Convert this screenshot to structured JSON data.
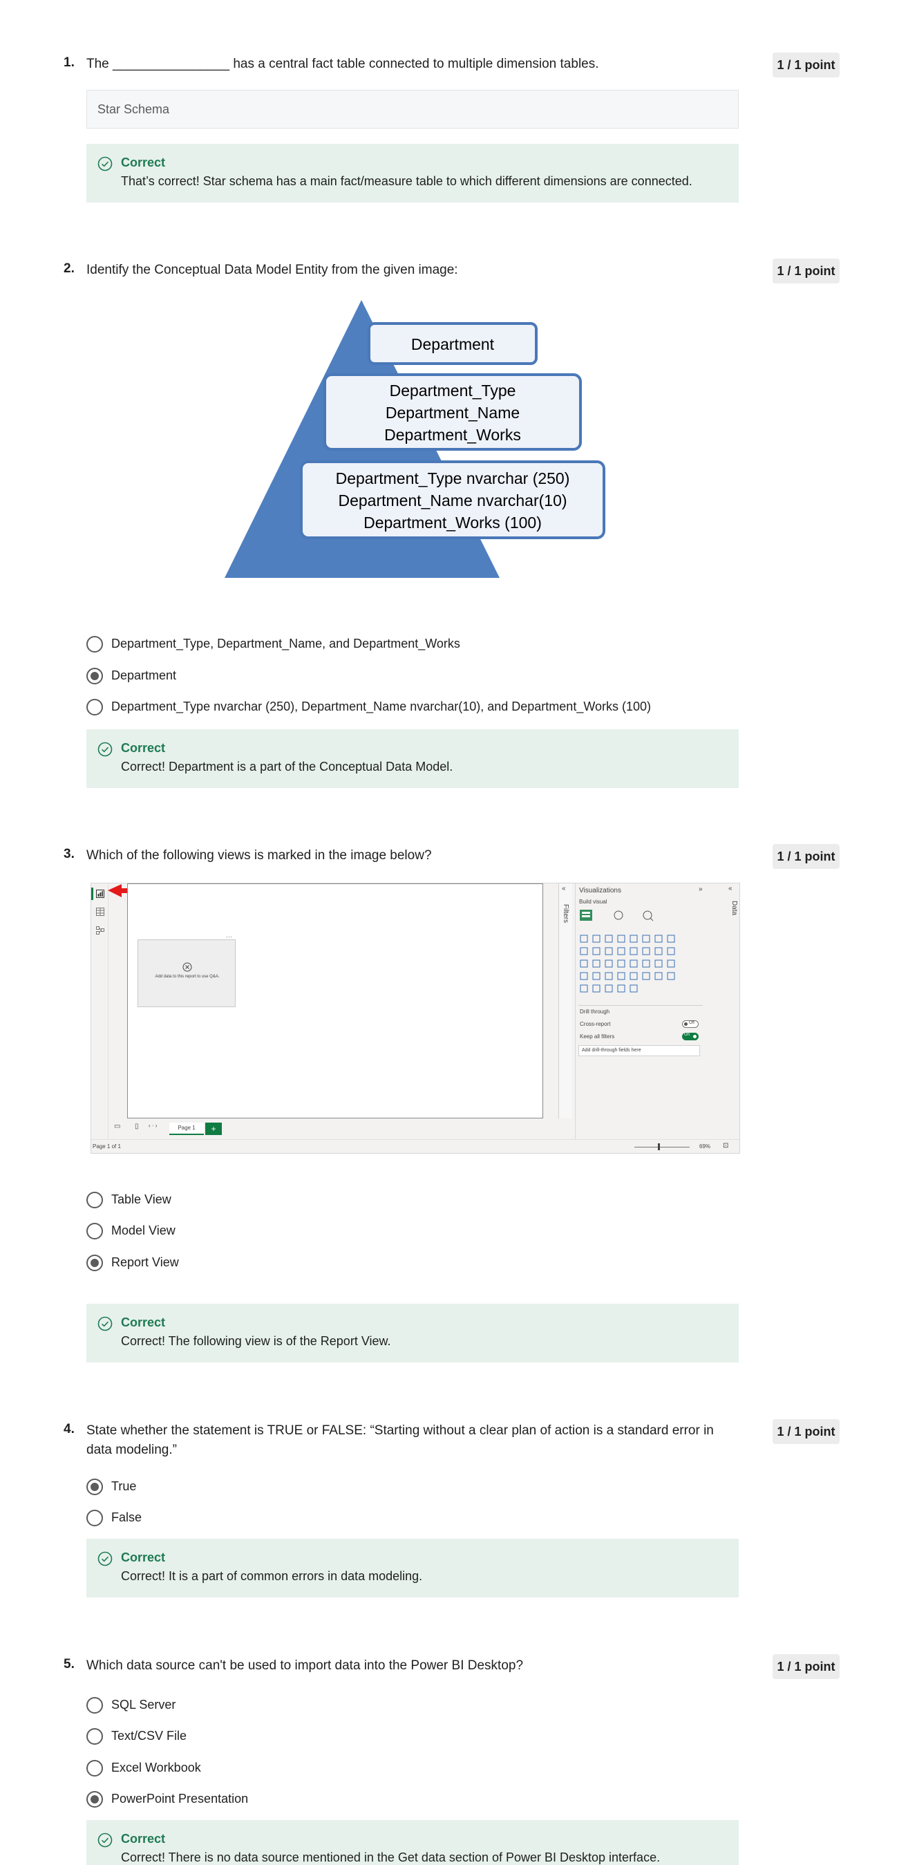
{
  "questions": [
    {
      "number": "1.",
      "text": "The ________________ has a central fact table connected to multiple dimension tables.",
      "points": "1 / 1 point",
      "answer": "Star Schema",
      "feedback": {
        "title": "Correct",
        "text": "That’s correct! Star schema has a main fact/measure table to which different dimensions are connected."
      }
    },
    {
      "number": "2.",
      "text": "Identify the Conceptual Data Model Entity from the given image:",
      "points": "1 / 1 point",
      "image": {
        "box1": "Department",
        "box2": [
          "Department_Type",
          "Department_Name",
          "Department_Works"
        ],
        "box3": [
          "Department_Type nvarchar (250)",
          "Department_Name nvarchar(10)",
          "Department_Works (100)"
        ]
      },
      "options": [
        {
          "label": "Department_Type, Department_Name, and Department_Works",
          "selected": false
        },
        {
          "label": "Department",
          "selected": true
        },
        {
          "label": "Department_Type nvarchar (250), Department_Name nvarchar(10), and Department_Works (100)",
          "selected": false
        }
      ],
      "feedback": {
        "title": "Correct",
        "text": "Correct! Department is a part of the Conceptual Data Model."
      }
    },
    {
      "number": "3.",
      "text": "Which of the following views is marked in the image below?",
      "points": "1 / 1 point",
      "image": {
        "question_mark": "?",
        "visual_placeholder_text": "Add data to this report to use Q&A.",
        "panel_title": "Visualizations",
        "build_visual": "Build visual",
        "filters_tab": "Filters",
        "data_tab": "Data",
        "drill_through": "Drill through",
        "cross_report": "Cross-report",
        "cross_report_toggle": "Off",
        "keep_all_filters": "Keep all filters",
        "keep_all_filters_toggle": "On",
        "drill_fields_placeholder": "Add drill-through fields here",
        "page_tab": "Page 1",
        "add_page": "+",
        "status": "Page 1 of 1",
        "zoom": "69%"
      },
      "options": [
        {
          "label": "Table View",
          "selected": false
        },
        {
          "label": "Model View",
          "selected": false
        },
        {
          "label": "Report View",
          "selected": true
        }
      ],
      "feedback": {
        "title": "Correct",
        "text": "Correct! The following view is of the Report View."
      }
    },
    {
      "number": "4.",
      "text": "State whether the statement is TRUE or FALSE: “Starting without a clear plan of action is a standard error in data modeling.”",
      "points": "1 / 1 point",
      "options": [
        {
          "label": "True",
          "selected": true
        },
        {
          "label": "False",
          "selected": false
        }
      ],
      "feedback": {
        "title": "Correct",
        "text": "Correct! It is a part of common errors in data modeling."
      }
    },
    {
      "number": "5.",
      "text": "Which data source can't be used to import data into the Power BI Desktop?",
      "points": "1 / 1 point",
      "options": [
        {
          "label": "SQL Server",
          "selected": false
        },
        {
          "label": "Text/CSV File",
          "selected": false
        },
        {
          "label": "Excel Workbook",
          "selected": false
        },
        {
          "label": "PowerPoint Presentation",
          "selected": true
        }
      ],
      "feedback": {
        "title": "Correct",
        "text": "Correct! There is no data source mentioned in the Get data section of Power BI Desktop interface."
      }
    }
  ],
  "colors": {
    "correct": "#1e7a52",
    "feedback_bg": "#e6f1ec",
    "pyramid": "#4f7fbf",
    "arrow": "#e31b1b"
  }
}
